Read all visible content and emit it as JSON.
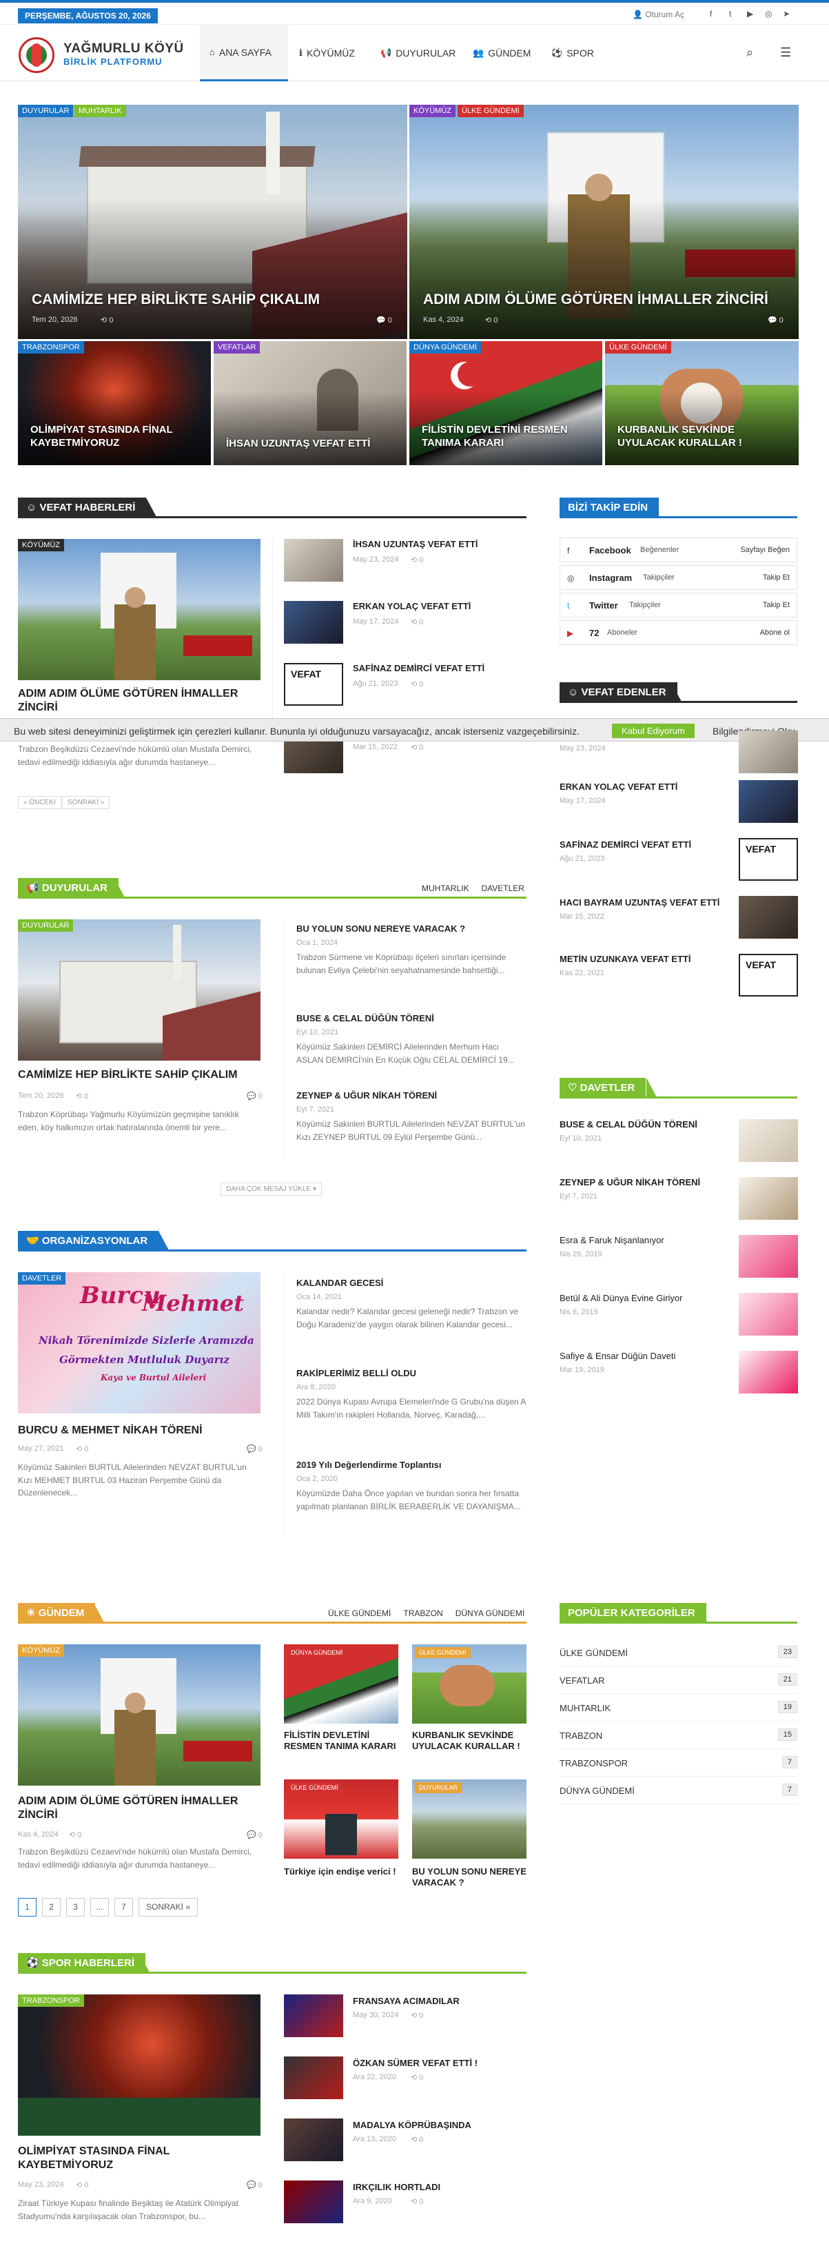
{
  "topbar": {
    "date": "PERŞEMBE, AĞUSTOS 20, 2026",
    "login": "Oturum Aç",
    "social": [
      "f",
      "t",
      "▶",
      "◎",
      "➤"
    ]
  },
  "logo": {
    "line1": "YAĞMURLU KÖYÜ",
    "line2": "BİRLİK PLATFORMU"
  },
  "nav": [
    {
      "label": "ANA SAYFA",
      "icon": "⌂"
    },
    {
      "label": "KÖYÜMÜZ",
      "icon": "ℹ"
    },
    {
      "label": "DUYURULAR",
      "icon": "📢"
    },
    {
      "label": "GÜNDEM",
      "icon": "👥"
    },
    {
      "label": "SPOR",
      "icon": "⚽"
    }
  ],
  "hero": [
    {
      "cats": [
        "DUYURULAR",
        "MUHTARLIK"
      ],
      "title": "CAMİMİZE HEP BİRLİKTE SAHİP ÇIKALIM",
      "date": "Tem 20, 2026",
      "likes": "0",
      "comments": "0"
    },
    {
      "cats": [
        "KÖYÜMÜZ",
        "ÜLKE GÜNDEMİ"
      ],
      "title": "ADIM ADIM ÖLÜME GÖTÜREN İHMALLER ZİNCİRİ",
      "date": "Kas 4, 2024",
      "likes": "0",
      "comments": "0"
    },
    {
      "cat": "TRABZONSPOR",
      "title": "OLİMPİYAT STASINDA FİNAL KAYBETMİYORUZ"
    },
    {
      "cat": "VEFATLAR",
      "title": "İHSAN UZUNTAŞ VEFAT ETTİ"
    },
    {
      "cat": "DÜNYA GÜNDEMİ",
      "title": "FİLİSTİN DEVLETİNİ RESMEN TANIMA KARARI"
    },
    {
      "cat": "ÜLKE GÜNDEMİ",
      "title": "KURBANLIK SEVKİNDE UYULACAK KURALLAR !"
    }
  ],
  "vefat": {
    "header": "VEFAT HABERLERİ",
    "main": {
      "cat": "KÖYÜMÜZ",
      "title": "ADIM ADIM ÖLÜME GÖTÜREN İHMALLER ZİNCİRİ",
      "excerpt": "Trabzon Beşikdüzü Cezaevi'nde hükümlü olan Mustafa Demirci, tedavi edilmediği iddiasıyla ağır durumda hastaneye..."
    },
    "list": [
      {
        "title": "İHSAN UZUNTAŞ VEFAT ETTİ",
        "date": "May 23, 2024",
        "likes": "0"
      },
      {
        "title": "ERKAN YOLAÇ VEFAT ETTİ",
        "date": "May 17, 2024",
        "likes": "0"
      },
      {
        "title": "SAFİNAZ DEMİRCİ VEFAT ETTİ",
        "date": "Ağu 21, 2023",
        "likes": "0"
      },
      {
        "title": "",
        "date": "Mar 15, 2022",
        "likes": "0"
      }
    ],
    "prev": "« ÖNCEKİ",
    "next": "SONRAKİ »"
  },
  "cookie": {
    "text": "Bu web sitesi deneyiminizi geliştirmek için çerezleri kullanır. Bununla iyi olduğunuzu varsayacağız, ancak isterseniz vazgeçebilirsiniz.",
    "accept": "Kabul Ediyorum",
    "reject": "Bilgilendirmeyi Oku"
  },
  "duyurular": {
    "header": "DUYURULAR",
    "tabs": [
      "MUHTARLIK",
      "DAVETLER"
    ],
    "main": {
      "cat": "DUYURULAR",
      "title": "CAMİMİZE HEP BİRLİKTE SAHİP ÇIKALIM",
      "date": "Tem 20, 2026",
      "likes": "0",
      "comments": "0",
      "excerpt": "Trabzon Köprübaşı Yağmurlu Köyümüzün geçmişine tanıklık eden, köy halkımızın ortak hatıralarında önemli bir yere..."
    },
    "list": [
      {
        "title": "BU YOLUN SONU NEREYE VARACAK ?",
        "date": "Oca 1, 2024",
        "excerpt": "Trabzon Sürmene ve Köprübaşı ilçeleri sınırları içerisinde bulunan Evliya Çelebi'nin seyahatnamesinde bahsettiği..."
      },
      {
        "title": "BUSE & CELAL DÜĞÜN TÖRENİ",
        "date": "Eyl 10, 2021",
        "excerpt": "Köyümüz Sakinleri DEMİRCİ Ailelerinden Merhum Hacı ASLAN DEMİRCİ'nin En Küçük Oğlu CELAL DEMİRCİ 19..."
      },
      {
        "title": "ZEYNEP & UĞUR NİKAH TÖRENİ",
        "date": "Eyl 7, 2021",
        "excerpt": "Köyümüz Sakinleri BURTUL Ailelerinden NEVZAT BURTUL'un Kızı ZEYNEP BURTUL 09 Eylül Perşembe Günü..."
      }
    ],
    "loadmore": "DAHA ÇOK MESAJ YÜKLE ▾"
  },
  "org": {
    "header": "ORGANİZASYONLAR",
    "main": {
      "cat": "DAVETLER",
      "img_line1": "Burcu",
      "img_line2": "Mehmet",
      "img_line3": "Nikah Törenimizde Sizlerle Aramızda",
      "img_line4": "Görmekten Mutluluk Duyarız",
      "img_line5": "Kaya ve Burtul Aileleri",
      "title": "BURCU & MEHMET NİKAH TÖRENİ",
      "date": "May 27, 2021",
      "likes": "0",
      "comments": "0",
      "excerpt": "Köyümüz Sakinleri BURTUL Ailelerinden NEVZAT BURTUL'un Kızı MEHMET BURTUL 03 Haziran Perşembe Günü da Düzenlenecek..."
    },
    "list": [
      {
        "title": "KALANDAR GECESİ",
        "date": "Oca 14, 2021",
        "excerpt": "Kalandar nedir? Kalandar gecesi geleneği nedir? Trabzon ve Doğu Karadeniz'de yaygın olarak bilinen Kalandar gecesi..."
      },
      {
        "title": "RAKİPLERİMİZ BELLİ OLDU",
        "date": "Ara 8, 2020",
        "excerpt": "2022 Dünya Kupası Avrupa Elemeleri'nde G Grubu'na düşen A Milli Takım'ın rakipleri Hollanda, Norveç, Karadağ,..."
      },
      {
        "title": "2019 Yılı Değerlendirme Toplantısı",
        "date": "Oca 2, 2020",
        "excerpt": "Köyümüzde Daha Önce yapılan ve bundan sonra her fırsatta yapılmatı planlanan BİRLİK BERABERLİK VE DAYANIŞMA..."
      }
    ]
  },
  "gundem": {
    "header": "GÜNDEM",
    "tabs": [
      "ÜLKE GÜNDEMİ",
      "TRABZON",
      "DÜNYA GÜNDEMİ"
    ],
    "main": {
      "cat": "KÖYÜMÜZ",
      "title": "ADIM ADIM ÖLÜME GÖTÜREN İHMALLER ZİNCİRİ",
      "date": "Kas 4, 2024",
      "likes": "0",
      "comments": "0",
      "excerpt": "Trabzon Beşikdüzü Cezaevi'nde hükümlü olan Mustafa Demirci, tedavi edilmediği iddiasıyla ağır durumda hastaneye..."
    },
    "grid": [
      {
        "cat": "DÜNYA GÜNDEMİ",
        "title": "FİLİSTİN DEVLETİNİ RESMEN TANIMA KARARI"
      },
      {
        "cat": "ÜLKE GÜNDEMİ",
        "title": "KURBANLIK SEVKİNDE UYULACAK KURALLAR !"
      },
      {
        "cat": "ÜLKE GÜNDEMİ",
        "title": "Türkiye için endişe verici !"
      },
      {
        "cat": "DUYURULAR",
        "title": "BU YOLUN SONU NEREYE VARACAK ?"
      }
    ],
    "pages": [
      "1",
      "2",
      "3",
      "...",
      "7"
    ],
    "next": "SONRAKİ »"
  },
  "spor": {
    "header": "SPOR HABERLERİ",
    "main": {
      "cat": "TRABZONSPOR",
      "title": "OLİMPİYAT STASINDA FİNAL KAYBETMİYORUZ",
      "date": "May 23, 2024",
      "likes": "0",
      "comments": "0",
      "excerpt": "Ziraat Türkiye Kupası finalinde Beşiktaş ile Atatürk Olimpiyat Stadyumu'nda karşılaşacak olan Trabzonspor, bu..."
    },
    "list": [
      {
        "title": "FRANSAYA ACIMADILAR",
        "date": "May 30, 2024",
        "likes": "0"
      },
      {
        "title": "ÖZKAN SÜMER VEFAT ETTİ !",
        "date": "Ara 22, 2020",
        "likes": "0"
      },
      {
        "title": "MADALYA KÖPRÜBAŞINDA",
        "date": "Ara 13, 2020",
        "likes": "0"
      },
      {
        "title": "IRKÇILIK HORTLADI",
        "date": "Ara 9, 2020",
        "likes": "0"
      }
    ]
  },
  "sidebar": {
    "follow_header": "BİZİ TAKİP EDİN",
    "follow": [
      {
        "icon": "f",
        "name": "Facebook",
        "sub": "Beğenenler",
        "action": "Sayfayı Beğen"
      },
      {
        "icon": "◎",
        "name": "Instagram",
        "sub": "Takipçiler",
        "action": "Takip Et"
      },
      {
        "icon": "t",
        "name": "Twitter",
        "sub": "Takipçiler",
        "action": "Takip Et"
      },
      {
        "icon": "▶",
        "name": "72",
        "sub": "Aboneler",
        "action": "Abone ol"
      }
    ],
    "vefat_header": "VEFAT EDENLER",
    "vefat": [
      {
        "title": "",
        "date": "May 23, 2024"
      },
      {
        "title": "ERKAN YOLAÇ VEFAT ETTİ",
        "date": "May 17, 2024"
      },
      {
        "title": "SAFİNAZ DEMİRCİ VEFAT ETTİ",
        "date": "Ağu 21, 2023"
      },
      {
        "title": "HACI BAYRAM UZUNTAŞ VEFAT ETTİ",
        "date": "Mar 15, 2022"
      },
      {
        "title": "METİN UZUNKAYA VEFAT ETTİ",
        "date": "Kas 22, 2021"
      }
    ],
    "vefat_stamp": "VEFAT",
    "davet_header": "DAVETLER",
    "davetler": [
      {
        "title": "BUSE & CELAL DÜĞÜN TÖRENİ",
        "date": "Eyl 10, 2021"
      },
      {
        "title": "ZEYNEP & UĞUR NİKAH TÖRENİ",
        "date": "Eyl 7, 2021"
      },
      {
        "title": "Esra & Faruk Nişanlanıyor",
        "date": "Nis 29, 2019"
      },
      {
        "title": "Betül & Ali Dünya Evine Giriyor",
        "date": "Nis 6, 2019"
      },
      {
        "title": "Safiye & Ensar Düğün Daveti",
        "date": "Mar 19, 2019"
      }
    ],
    "cat_header": "POPÜLER KATEGORİLER",
    "categories": [
      {
        "name": "ÜLKE GÜNDEMİ",
        "count": "23"
      },
      {
        "name": "VEFATLAR",
        "count": "21"
      },
      {
        "name": "MUHTARLIK",
        "count": "19"
      },
      {
        "name": "TRABZON",
        "count": "15"
      },
      {
        "name": "TRABZONSPOR",
        "count": "7"
      },
      {
        "name": "DÜNYA GÜNDEMİ",
        "count": "7"
      }
    ]
  },
  "colors": {
    "blue": "#1b76c8",
    "green": "#7cbf2f",
    "orange": "#e8a53a",
    "dark": "#2b2b2b",
    "red": "#d32f2f",
    "purple": "#7b3fbf"
  }
}
